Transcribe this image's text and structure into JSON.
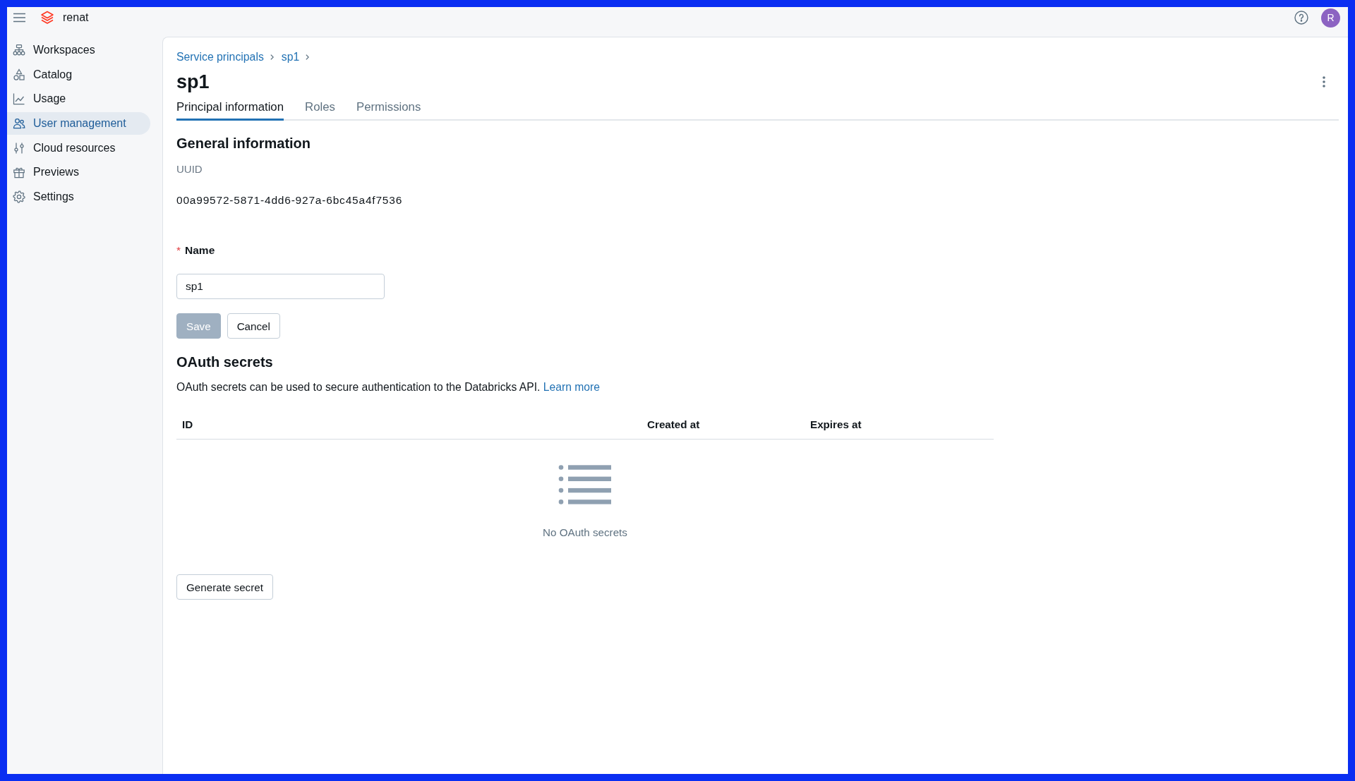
{
  "top_bar": {
    "org_name": "renat",
    "avatar_initial": "R"
  },
  "sidebar": {
    "items": [
      {
        "label": "Workspaces",
        "selected": false
      },
      {
        "label": "Catalog",
        "selected": false
      },
      {
        "label": "Usage",
        "selected": false
      },
      {
        "label": "User management",
        "selected": true
      },
      {
        "label": "Cloud resources",
        "selected": false
      },
      {
        "label": "Previews",
        "selected": false
      },
      {
        "label": "Settings",
        "selected": false
      }
    ]
  },
  "breadcrumb": [
    "Service principals",
    "sp1"
  ],
  "title": "sp1",
  "tabs": [
    {
      "label": "Principal information",
      "selected": true
    },
    {
      "label": "Roles",
      "selected": false
    },
    {
      "label": "Permissions",
      "selected": false
    }
  ],
  "general_information": {
    "heading": "General information",
    "uuid_label": "UUID",
    "uuid_value": "00a99572-5871-4dd6-927a-6bc45a4f7536",
    "name_field": {
      "required_mark": "*",
      "label": "Name",
      "value": "sp1"
    },
    "buttons": [
      {
        "label": "Save",
        "disabled": true
      },
      {
        "label": "Cancel",
        "disabled": false
      }
    ]
  },
  "oauth_secrets": {
    "heading": "OAuth secrets",
    "description": "OAuth secrets can be used to secure authentication to the Databricks API.",
    "link": "Learn more",
    "table": {
      "columns": [
        "ID",
        "Created at",
        "Expires at"
      ],
      "empty_text": "No OAuth secrets"
    },
    "generate_button": "Generate secret"
  }
}
